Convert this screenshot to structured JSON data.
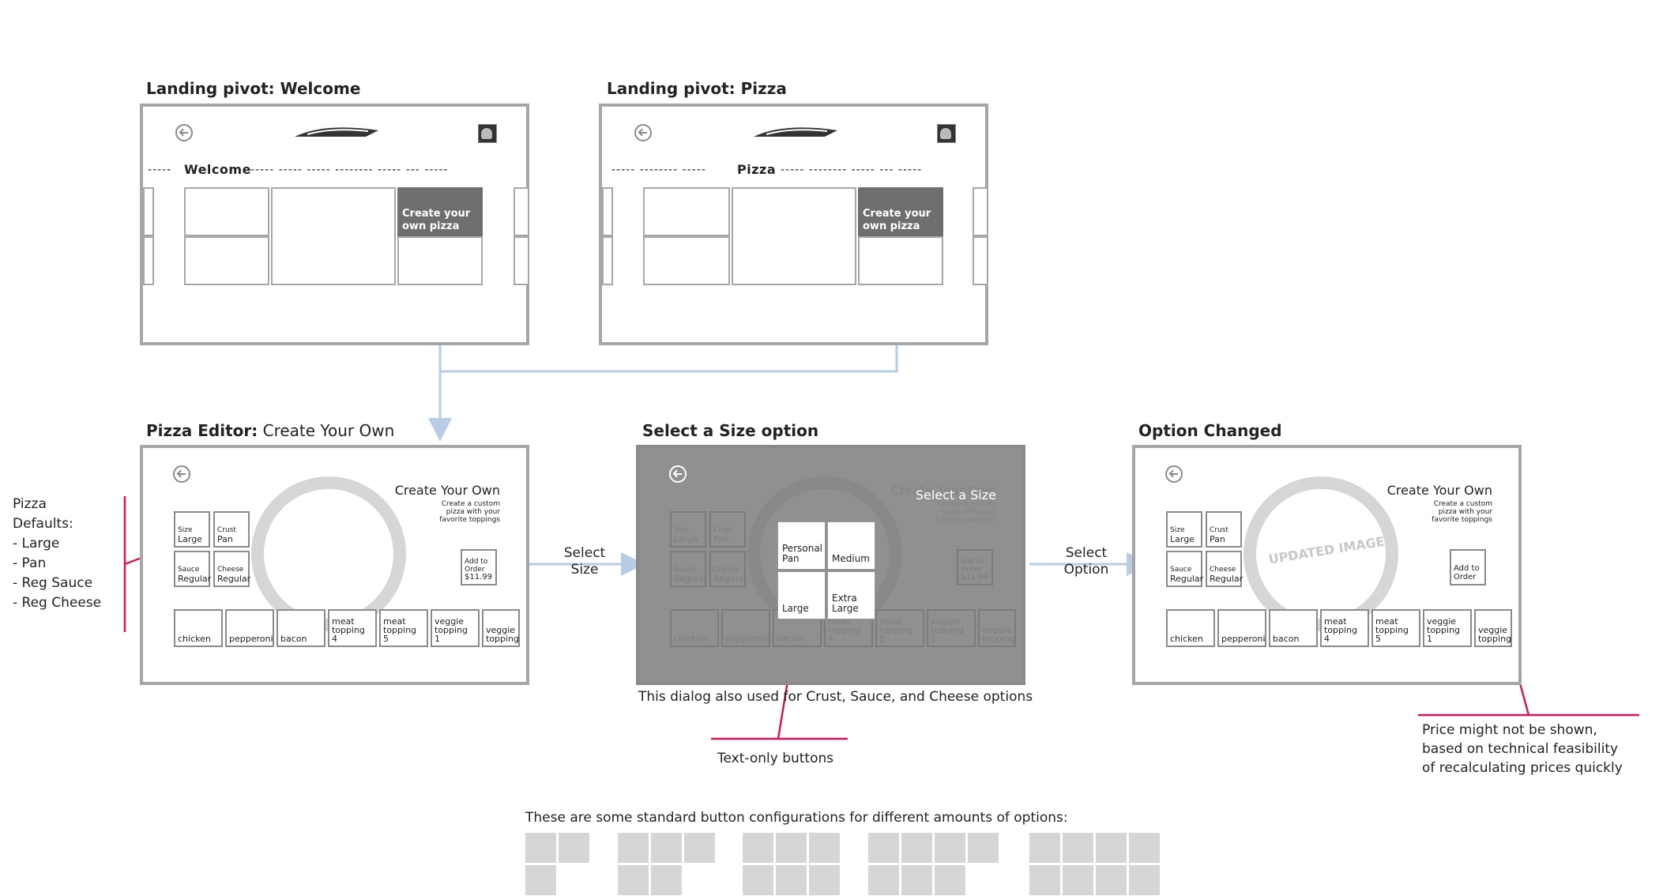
{
  "screens": {
    "welcome": {
      "title_bold": "Landing pivot: Welcome",
      "pivot_current": "Welcome",
      "tile_label": "Create your own pizza"
    },
    "pizza": {
      "title_bold": "Landing pivot: Pizza",
      "pivot_current": "Pizza",
      "tile_label": "Create your own pizza"
    },
    "editor": {
      "title_bold": "Pizza Editor:",
      "title_rest": " Create Your Own",
      "header": "Create Your Own",
      "subheader": "Create a custom pizza with your favorite toppings",
      "size_label": "Size",
      "size_value": "Large",
      "crust_label": "Crust",
      "crust_value": "Pan",
      "sauce_label": "Sauce",
      "sauce_value": "Regular",
      "cheese_label": "Cheese",
      "cheese_value": "Regular",
      "add_to_order": "Add to Order",
      "price": "$11.99",
      "toppings": [
        "chicken",
        "pepperoni",
        "bacon",
        "meat topping 4",
        "meat topping 5",
        "veggie topping 1",
        "veggie topping"
      ]
    },
    "select": {
      "title_bold": "Select a Size option",
      "dialog_title": "Select a Size",
      "options": [
        "Personal Pan",
        "Medium",
        "Large",
        "Extra Large"
      ],
      "caption": "This dialog also used for Crust, Sauce, and Cheese options"
    },
    "changed": {
      "title_bold": "Option Changed",
      "header": "Create Your Own",
      "subheader": "Create a custom pizza with your favorite toppings",
      "updated_image": "UPDATED IMAGE",
      "add_to_order": "Add to Order"
    }
  },
  "pivot_dashes": {
    "welcome_left": "-----",
    "welcome_right": "-----  -----  -----  --------  -----  ---  -----",
    "pizza_left": "-----  --------  -----",
    "pizza_right": "-----  --------  -----  ---  -----"
  },
  "annotations": {
    "defaults": [
      "Pizza",
      "Defaults:",
      "- Large",
      "- Pan",
      "- Reg Sauce",
      "- Reg Cheese"
    ],
    "select_size": [
      "Select",
      "Size"
    ],
    "select_option": [
      "Select",
      "Option"
    ],
    "text_only": "Text-only buttons",
    "price_note": [
      "Price might not be shown,",
      "based on technical feasibility",
      "of recalculating prices quickly"
    ]
  },
  "configs_caption": "These are some standard button configurations for different amounts of options:",
  "colors": {
    "accent": "#d4145a",
    "flow": "#b8cce4",
    "frame": "#a6a6a6",
    "dark_tile": "#6e6e6e"
  },
  "icons": [
    "back-arrow-icon",
    "pizza-hut-logo",
    "avatar-icon"
  ]
}
